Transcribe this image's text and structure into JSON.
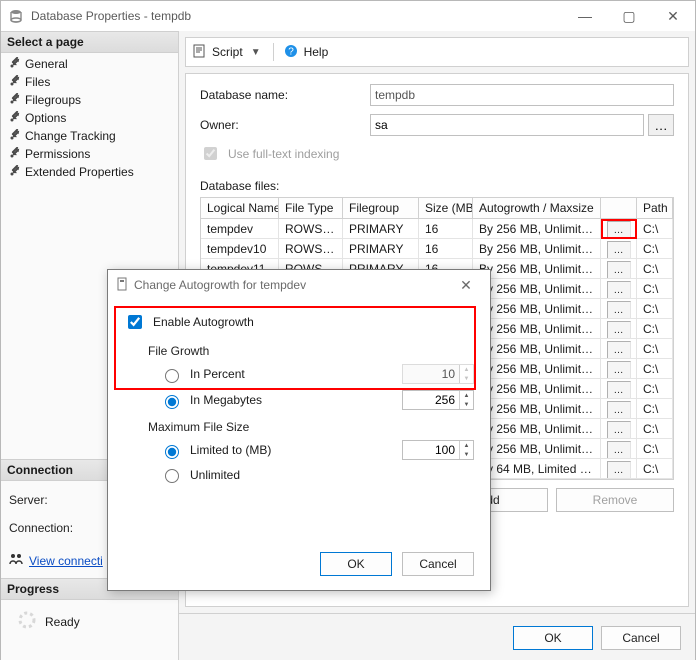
{
  "window": {
    "title": "Database Properties - tempdb"
  },
  "left": {
    "select_page": "Select a page",
    "pages": [
      "General",
      "Files",
      "Filegroups",
      "Options",
      "Change Tracking",
      "Permissions",
      "Extended Properties"
    ],
    "connection_hdr": "Connection",
    "server_label": "Server:",
    "connection_label": "Connection:",
    "view_conn": "View connecti",
    "progress_hdr": "Progress",
    "ready": "Ready"
  },
  "toolbar": {
    "script": "Script",
    "help": "Help"
  },
  "form": {
    "dbname_label": "Database name:",
    "dbname_value": "tempdb",
    "owner_label": "Owner:",
    "owner_value": "sa",
    "fulltext_label": "Use full-text indexing",
    "dbfiles_label": "Database files:",
    "cols": {
      "c0": "Logical Name",
      "c1": "File Type",
      "c2": "Filegroup",
      "c3": "Size (MB)",
      "c4": "Autogrowth / Maxsize",
      "c6": "Path"
    },
    "rows": [
      {
        "c0": "tempdev",
        "c1": "ROWS…",
        "c2": "PRIMARY",
        "c3": "16",
        "c4": "By 256 MB, Unlimited",
        "c6": "C:\\",
        "hl": true
      },
      {
        "c0": "tempdev10",
        "c1": "ROWS…",
        "c2": "PRIMARY",
        "c3": "16",
        "c4": "By 256 MB, Unlimited",
        "c6": "C:\\"
      },
      {
        "c0": "tempdev11",
        "c1": "ROWS…",
        "c2": "PRIMARY",
        "c3": "16",
        "c4": "By 256 MB, Unlimited",
        "c6": "C:\\"
      },
      {
        "c0": "",
        "c1": "",
        "c2": "",
        "c3": "",
        "c4": "By 256 MB, Unlimited",
        "c6": "C:\\"
      },
      {
        "c0": "",
        "c1": "",
        "c2": "",
        "c3": "",
        "c4": "By 256 MB, Unlimited",
        "c6": "C:\\"
      },
      {
        "c0": "",
        "c1": "",
        "c2": "",
        "c3": "",
        "c4": "By 256 MB, Unlimited",
        "c6": "C:\\"
      },
      {
        "c0": "",
        "c1": "",
        "c2": "",
        "c3": "",
        "c4": "By 256 MB, Unlimited",
        "c6": "C:\\"
      },
      {
        "c0": "",
        "c1": "",
        "c2": "",
        "c3": "",
        "c4": "By 256 MB, Unlimited",
        "c6": "C:\\"
      },
      {
        "c0": "",
        "c1": "",
        "c2": "",
        "c3": "",
        "c4": "By 256 MB, Unlimited",
        "c6": "C:\\"
      },
      {
        "c0": "",
        "c1": "",
        "c2": "",
        "c3": "",
        "c4": "By 256 MB, Unlimited",
        "c6": "C:\\"
      },
      {
        "c0": "",
        "c1": "",
        "c2": "",
        "c3": "",
        "c4": "By 256 MB, Unlimited",
        "c6": "C:\\"
      },
      {
        "c0": "",
        "c1": "",
        "c2": "",
        "c3": "",
        "c4": "By 256 MB, Unlimited",
        "c6": "C:\\"
      },
      {
        "c0": "",
        "c1": "",
        "c2": "",
        "c3": "",
        "c4": "By 64 MB, Limited to 2…",
        "c6": "C:\\"
      }
    ]
  },
  "buttons": {
    "add": "Add",
    "remove": "Remove",
    "ok": "OK",
    "cancel": "Cancel"
  },
  "modal": {
    "title": "Change Autogrowth for tempdev",
    "enable": "Enable Autogrowth",
    "filegrowth": "File Growth",
    "in_percent": "In Percent",
    "in_mb": "In Megabytes",
    "percent_val": "10",
    "mb_val": "256",
    "maxsize": "Maximum File Size",
    "limited_to": "Limited to (MB)",
    "unlimited": "Unlimited",
    "limit_val": "100",
    "ok": "OK",
    "cancel": "Cancel"
  }
}
